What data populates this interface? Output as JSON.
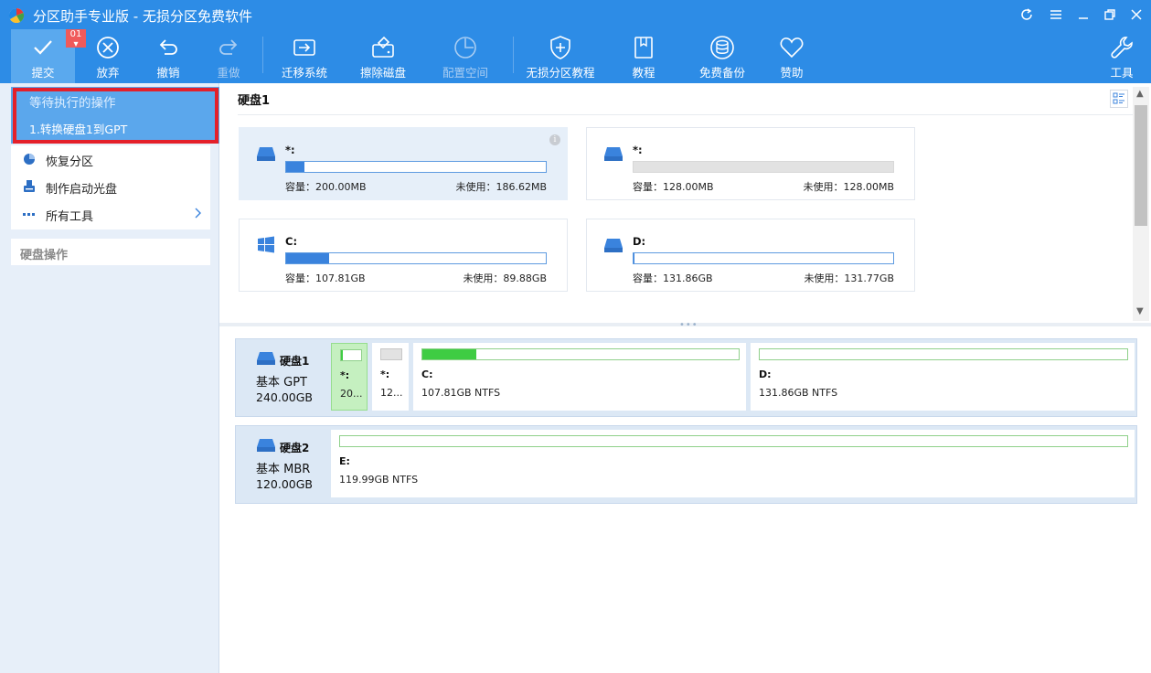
{
  "window": {
    "title": "分区助手专业版 - 无损分区免费软件"
  },
  "toolbar": {
    "commit": {
      "label": "提交",
      "badge": "01"
    },
    "discard": {
      "label": "放弃"
    },
    "undo": {
      "label": "撤销"
    },
    "redo": {
      "label": "重做"
    },
    "migrate": {
      "label": "迁移系统"
    },
    "wipe": {
      "label": "擦除磁盘"
    },
    "allocate": {
      "label": "配置空间"
    },
    "tutorial_lossless": {
      "label": "无损分区教程"
    },
    "tutorial": {
      "label": "教程"
    },
    "backup": {
      "label": "免费备份"
    },
    "donate": {
      "label": "赞助"
    },
    "tools": {
      "label": "工具"
    }
  },
  "sidebar": {
    "pending": {
      "title": "等待执行的操作",
      "items": [
        "1.转换硬盘1到GPT"
      ]
    },
    "menu": [
      {
        "label": "恢复分区",
        "icon": "pie-chart-icon"
      },
      {
        "label": "制作启动光盘",
        "icon": "usb-drive-icon"
      },
      {
        "label": "所有工具",
        "icon": "dots-icon"
      }
    ],
    "disk_ops_title": "硬盘操作"
  },
  "overview": {
    "disk_title": "硬盘1",
    "partitions": [
      {
        "name": "*:",
        "capacity": "容量：200.00MB",
        "free": "未使用：186.62MB",
        "used_fraction": 0.07,
        "icon": "drive-icon"
      },
      {
        "name": "*:",
        "capacity": "容量：128.00MB",
        "free": "未使用：128.00MB",
        "used_fraction": 0.0,
        "icon": "drive-icon"
      },
      {
        "name": "C:",
        "capacity": "容量：107.81GB",
        "free": "未使用：89.88GB",
        "used_fraction": 0.166,
        "icon": "windows-icon"
      },
      {
        "name": "D:",
        "capacity": "容量：131.86GB",
        "free": "未使用：131.77GB",
        "used_fraction": 0.001,
        "icon": "drive-icon"
      }
    ]
  },
  "disks": [
    {
      "name": "硬盘1",
      "type": "基本 GPT",
      "size": "240.00GB",
      "segments": [
        {
          "name": "*:",
          "info": "20...",
          "used_fraction": 0.1
        },
        {
          "name": "*:",
          "info": "12...",
          "used_fraction": 0.0
        },
        {
          "name": "C:",
          "info": "107.81GB NTFS",
          "used_fraction": 0.17
        },
        {
          "name": "D:",
          "info": "131.86GB NTFS",
          "used_fraction": 0.0
        }
      ]
    },
    {
      "name": "硬盘2",
      "type": "基本 MBR",
      "size": "120.00GB",
      "segments": [
        {
          "name": "E:",
          "info": "119.99GB NTFS",
          "used_fraction": 0.0
        }
      ]
    }
  ],
  "colors": {
    "accent": "#2d8ce6",
    "selected_bar": "#3a83dd",
    "used_bar": "#3fcc43",
    "highlight": "#e4202a"
  }
}
